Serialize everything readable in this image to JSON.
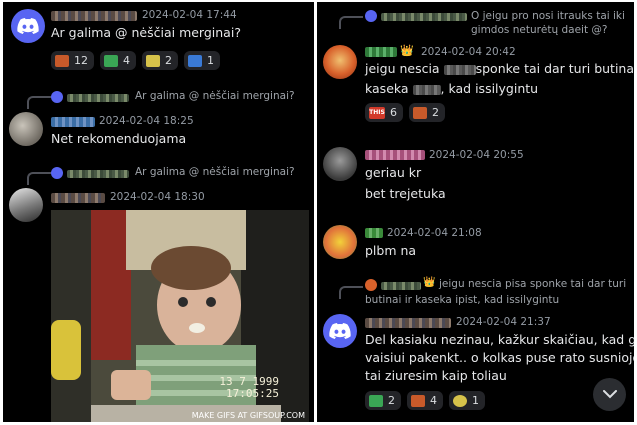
{
  "left": {
    "messages": [
      {
        "time": "2024-02-04 17:44",
        "text": "Ar galima @ nėščiai merginai?",
        "reactions": [
          {
            "count": "12",
            "color": "#c85a2a"
          },
          {
            "count": "4",
            "color": "#3aa655"
          },
          {
            "count": "2",
            "color": "#d6c24a"
          },
          {
            "count": "1",
            "color": "#3a7ad6"
          }
        ]
      },
      {
        "reply": "Ar galima @ nėščiai merginai?",
        "time": "2024-02-04 18:25",
        "text": "Net rekomenduojama"
      },
      {
        "reply": "Ar galima @ nėščiai merginai?",
        "time": "2024-02-04 18:30",
        "gif": {
          "stamp_line1": "13  7 1999",
          "stamp_line2": "17:05:25",
          "caption": "MAKE GIFS AT GIFSOUP.COM"
        }
      }
    ]
  },
  "right": {
    "messages": [
      {
        "reply": "O jeigu pro nosi itrauks tai iki gimdos neturėtų daeit @?",
        "time": "2024-02-04 20:42",
        "text_line1_a": "jeigu nescia",
        "text_line1_b": "sponke tai dar turi butinai ir",
        "text_line2_a": "kaseka",
        "text_line2_b": ", kad issilygintu",
        "reactions": [
          {
            "badge": "THIS",
            "count": "6",
            "color": "#d23a2a"
          },
          {
            "count": "2",
            "color": "#c85a2a"
          }
        ]
      },
      {
        "time": "2024-02-04 20:55",
        "text1": "geriau kr",
        "text2": "bet trejetuka"
      },
      {
        "time": "2024-02-04 21:08",
        "text": "plbm na"
      },
      {
        "reply_line1": "jeigu nescia pisa sponke tai dar turi",
        "reply_line2": "butinai ir kaseka ipist, kad issilygintu",
        "time": "2024-02-04 21:37",
        "text_lines": [
          "Del kasiaku nezinau, kažkur skaičiau, kad gali",
          "vaisiui pakenkt.. o kolkas puse rato susniojo",
          "tai ziuresim kaip toliau"
        ],
        "reactions": [
          {
            "count": "2",
            "color": "#3aa655"
          },
          {
            "count": "4",
            "color": "#c85a2a"
          },
          {
            "count": "1",
            "color": "#d6c24a"
          }
        ]
      }
    ]
  },
  "colors": {
    "discord": "#5865f2",
    "background": "#000000",
    "reaction_bg": "#232428"
  }
}
